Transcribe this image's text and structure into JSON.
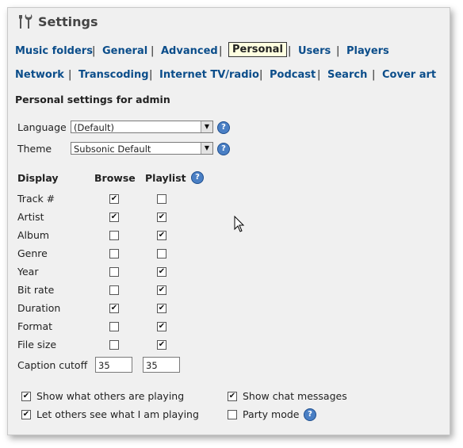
{
  "page": {
    "title": "Settings"
  },
  "nav": {
    "row1": [
      "Music folders",
      "General",
      "Advanced",
      "Personal",
      "Users",
      "Players"
    ],
    "row2": [
      "Network",
      "Transcoding",
      "Internet TV/radio",
      "Podcast",
      "Search",
      "Cover art"
    ],
    "active": "Personal",
    "separator": "|"
  },
  "section": {
    "heading": "Personal settings for admin"
  },
  "language": {
    "label": "Language",
    "value": "(Default)"
  },
  "theme": {
    "label": "Theme",
    "value": "Subsonic Default"
  },
  "display": {
    "headers": {
      "display": "Display",
      "browse": "Browse",
      "playlist": "Playlist"
    },
    "rows": [
      {
        "label": "Track #",
        "browse": true,
        "playlist": false
      },
      {
        "label": "Artist",
        "browse": true,
        "playlist": true
      },
      {
        "label": "Album",
        "browse": false,
        "playlist": true
      },
      {
        "label": "Genre",
        "browse": false,
        "playlist": false
      },
      {
        "label": "Year",
        "browse": false,
        "playlist": true
      },
      {
        "label": "Bit rate",
        "browse": false,
        "playlist": true
      },
      {
        "label": "Duration",
        "browse": true,
        "playlist": true
      },
      {
        "label": "Format",
        "browse": false,
        "playlist": true
      },
      {
        "label": "File size",
        "browse": false,
        "playlist": true
      }
    ],
    "caption_cutoff": {
      "label": "Caption cutoff",
      "browse_value": "35",
      "playlist_value": "35"
    }
  },
  "options": {
    "show_others_playing": {
      "label": "Show what others are playing",
      "checked": true
    },
    "let_others_see": {
      "label": "Let others see what I am playing",
      "checked": true
    },
    "show_chat": {
      "label": "Show chat messages",
      "checked": true
    },
    "party_mode": {
      "label": "Party mode",
      "checked": false
    }
  },
  "icons": {
    "settings": "tools-icon",
    "help": "help-icon",
    "cursor": "mouse-pointer-icon"
  },
  "colors": {
    "link": "#0b4d8a",
    "active_tab_bg": "#ffffe0",
    "help_icon": "#4a7fc4",
    "panel_bg": "#f0f0f0"
  }
}
